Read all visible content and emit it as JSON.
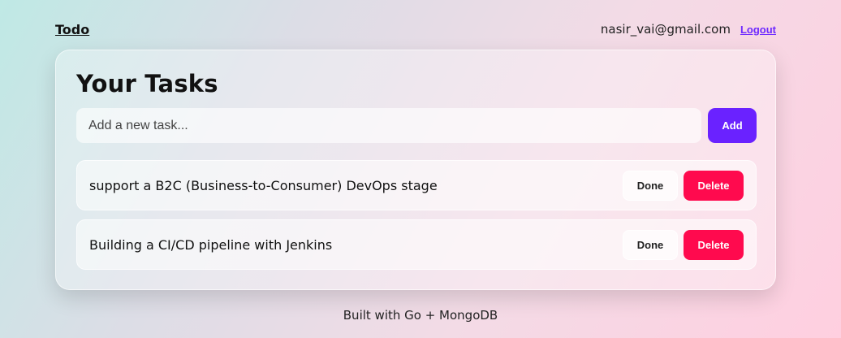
{
  "header": {
    "brand": "Todo",
    "user_email": "nasir_vai@gmail.com",
    "logout_label": "Logout"
  },
  "main": {
    "title": "Your Tasks",
    "new_task": {
      "placeholder": "Add a new task...",
      "value": "",
      "add_label": "Add"
    },
    "tasks": [
      {
        "text": "support a B2C (Business-to-Consumer) DevOps stage",
        "done_label": "Done",
        "delete_label": "Delete"
      },
      {
        "text": "Building a CI/CD pipeline with Jenkins",
        "done_label": "Done",
        "delete_label": "Delete"
      }
    ]
  },
  "footer": {
    "text": "Built with Go + MongoDB"
  },
  "colors": {
    "accent": "#6a22ff",
    "danger": "#ff0a4e",
    "link": "#6d28ff"
  }
}
